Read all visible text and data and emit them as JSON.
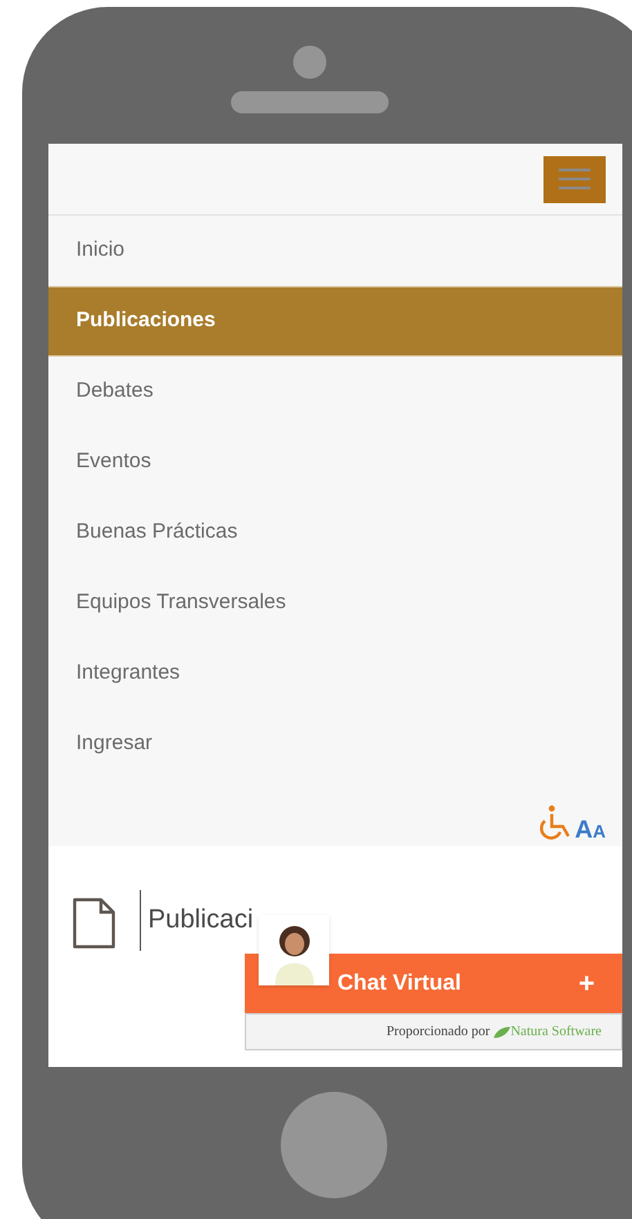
{
  "menu": [
    {
      "label": "Inicio",
      "selected": false
    },
    {
      "label": "Publicaciones",
      "selected": true
    },
    {
      "label": "Debates",
      "selected": false
    },
    {
      "label": "Eventos",
      "selected": false
    },
    {
      "label": "Buenas Prácticas",
      "selected": false
    },
    {
      "label": "Equipos Transversales",
      "selected": false
    },
    {
      "label": "Integrantes",
      "selected": false
    },
    {
      "label": "Ingresar",
      "selected": false
    }
  ],
  "text_size_letters": [
    "A",
    "A"
  ],
  "page_title": "Publicaci",
  "chat": {
    "title": "Chat Virtual",
    "toggle": "+",
    "powered_by": "Proporcionado por",
    "vendor": "Natura Software"
  }
}
